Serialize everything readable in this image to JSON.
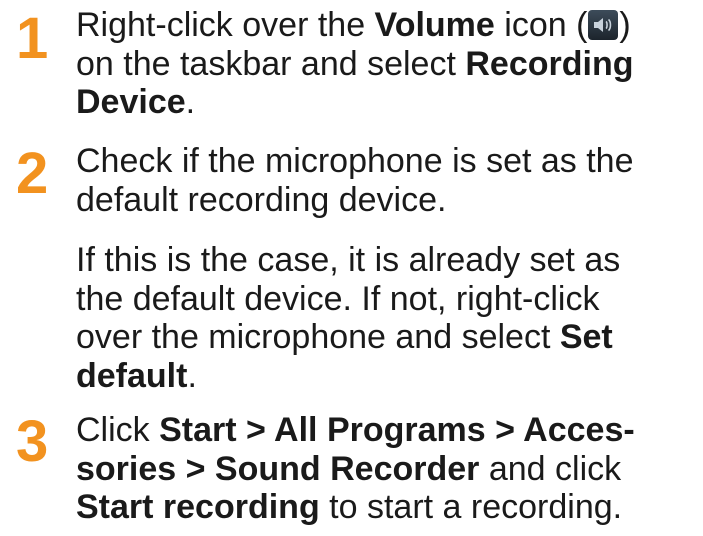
{
  "steps": [
    {
      "number": "1",
      "lines": [
        {
          "a": "Right-click over the ",
          "b": "Volume",
          "c": " icon (",
          "d": ")"
        },
        {
          "a": "on the taskbar and select ",
          "b": "Recording"
        },
        {
          "b": "Device",
          "c": "."
        }
      ],
      "icon": "speaker-volume-icon"
    },
    {
      "number": "2",
      "lines": [
        {
          "a": "Check if the microphone is set as the"
        },
        {
          "a": "default recording device."
        }
      ],
      "paragraph_lines": [
        {
          "a": "If this is the case, it is already set as"
        },
        {
          "a": "the default device. If not, right-click"
        },
        {
          "a": "over the microphone and select ",
          "b": "Set"
        },
        {
          "b": "default",
          "c": "."
        }
      ]
    },
    {
      "number": "3",
      "lines": [
        {
          "a": "Click ",
          "b": "Start > All Programs > Acces-"
        },
        {
          "b": "sories > Sound Recorder",
          "c": " and click"
        },
        {
          "b": "Start recording",
          "c": " to start a recording."
        }
      ]
    }
  ],
  "colors": {
    "step_number": "#f2921f",
    "text": "#1a1a1a"
  }
}
